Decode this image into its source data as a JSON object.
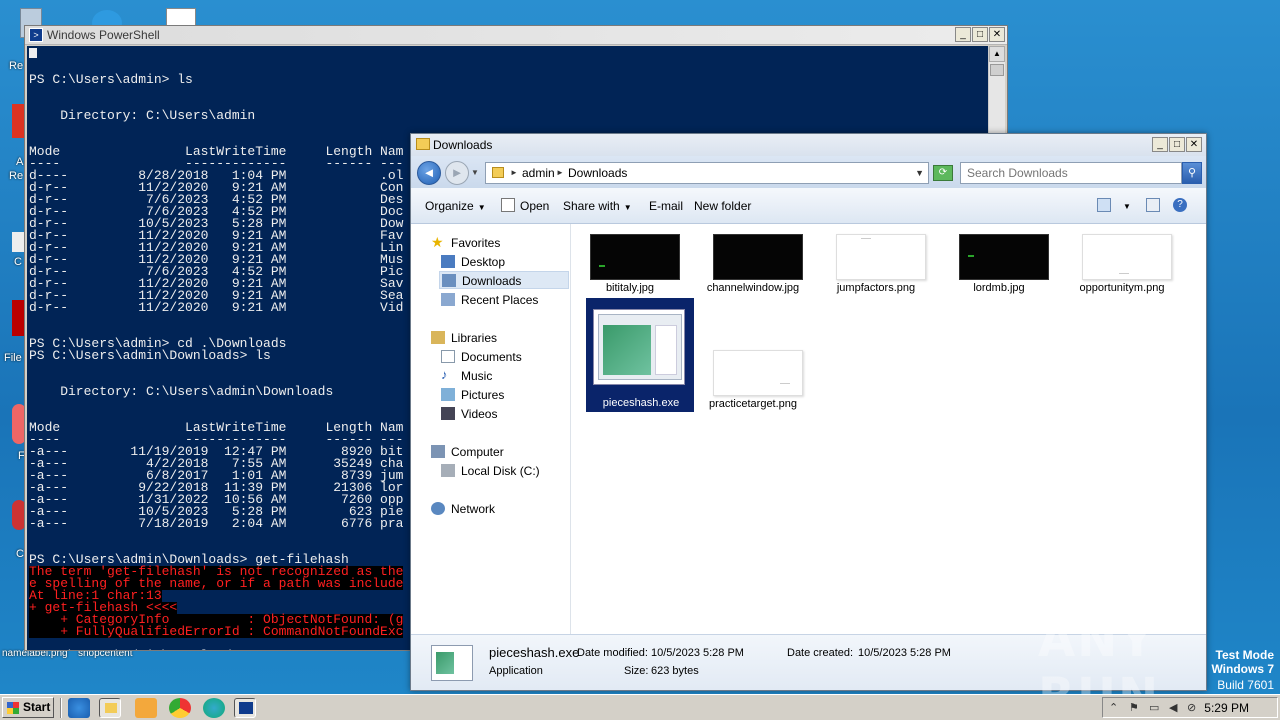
{
  "desktop": {
    "icon_labels": [
      "Re",
      "A",
      "Re",
      "C",
      "File",
      "F",
      "C",
      "namelabel.png",
      "snopcentent"
    ]
  },
  "powershell": {
    "title": "Windows PowerShell",
    "lines": [
      {
        "text": "PS C:\\Users\\admin> ls",
        "type": "normal"
      },
      {
        "text": "",
        "type": "normal"
      },
      {
        "text": "",
        "type": "normal"
      },
      {
        "text": "    Directory: C:\\Users\\admin",
        "type": "normal"
      },
      {
        "text": "",
        "type": "normal"
      },
      {
        "text": "",
        "type": "normal"
      },
      {
        "text": "Mode                LastWriteTime     Length Nam",
        "type": "normal"
      },
      {
        "text": "----                -------------     ------ ---",
        "type": "normal"
      },
      {
        "text": "d----         8/28/2018   1:04 PM            .ol",
        "type": "normal"
      },
      {
        "text": "d-r--         11/2/2020   9:21 AM            Con",
        "type": "normal"
      },
      {
        "text": "d-r--          7/6/2023   4:52 PM            Des",
        "type": "normal"
      },
      {
        "text": "d-r--          7/6/2023   4:52 PM            Doc",
        "type": "normal"
      },
      {
        "text": "d-r--         10/5/2023   5:28 PM            Dow",
        "type": "normal"
      },
      {
        "text": "d-r--         11/2/2020   9:21 AM            Fav",
        "type": "normal"
      },
      {
        "text": "d-r--         11/2/2020   9:21 AM            Lin",
        "type": "normal"
      },
      {
        "text": "d-r--         11/2/2020   9:21 AM            Mus",
        "type": "normal"
      },
      {
        "text": "d-r--          7/6/2023   4:52 PM            Pic",
        "type": "normal"
      },
      {
        "text": "d-r--         11/2/2020   9:21 AM            Sav",
        "type": "normal"
      },
      {
        "text": "d-r--         11/2/2020   9:21 AM            Sea",
        "type": "normal"
      },
      {
        "text": "d-r--         11/2/2020   9:21 AM            Vid",
        "type": "normal"
      },
      {
        "text": "",
        "type": "normal"
      },
      {
        "text": "",
        "type": "normal"
      },
      {
        "text": "PS C:\\Users\\admin> cd .\\Downloads",
        "type": "normal"
      },
      {
        "text": "PS C:\\Users\\admin\\Downloads> ls",
        "type": "normal"
      },
      {
        "text": "",
        "type": "normal"
      },
      {
        "text": "",
        "type": "normal"
      },
      {
        "text": "    Directory: C:\\Users\\admin\\Downloads",
        "type": "normal"
      },
      {
        "text": "",
        "type": "normal"
      },
      {
        "text": "",
        "type": "normal"
      },
      {
        "text": "Mode                LastWriteTime     Length Nam",
        "type": "normal"
      },
      {
        "text": "----                -------------     ------ ---",
        "type": "normal"
      },
      {
        "text": "-a---        11/19/2019  12:47 PM       8920 bit",
        "type": "normal"
      },
      {
        "text": "-a---          4/2/2018   7:55 AM      35249 cha",
        "type": "normal"
      },
      {
        "text": "-a---          6/8/2017   1:01 AM       8739 jum",
        "type": "normal"
      },
      {
        "text": "-a---         9/22/2018  11:39 PM      21306 lor",
        "type": "normal"
      },
      {
        "text": "-a---         1/31/2022  10:56 AM       7260 opp",
        "type": "normal"
      },
      {
        "text": "-a---         10/5/2023   5:28 PM        623 pie",
        "type": "normal"
      },
      {
        "text": "-a---         7/18/2019   2:04 AM       6776 pra",
        "type": "normal"
      },
      {
        "text": "",
        "type": "normal"
      },
      {
        "text": "",
        "type": "normal"
      },
      {
        "text": "PS C:\\Users\\admin\\Downloads> get-filehash",
        "type": "normal"
      },
      {
        "text": "The term 'get-filehash' is not recognized as the",
        "type": "error"
      },
      {
        "text": "e spelling of the name, or if a path was include",
        "type": "error"
      },
      {
        "text": "At line:1 char:13",
        "type": "error"
      },
      {
        "text": "+ get-filehash <<<<",
        "type": "error"
      },
      {
        "text": "    + CategoryInfo          : ObjectNotFound: (g",
        "type": "error"
      },
      {
        "text": "    + FullyQualifiedErrorId : CommandNotFoundExc",
        "type": "error"
      },
      {
        "text": "",
        "type": "normal"
      },
      {
        "text": "PS C:\\Users\\admin\\Downloads>",
        "type": "normal"
      }
    ]
  },
  "explorer": {
    "title": "Downloads",
    "breadcrumb": [
      "admin",
      "Downloads"
    ],
    "search_placeholder": "Search Downloads",
    "toolbar": {
      "organize": "Organize",
      "open": "Open",
      "share_with": "Share with",
      "email": "E-mail",
      "new_folder": "New folder"
    },
    "nav": {
      "favorites": "Favorites",
      "desktop": "Desktop",
      "downloads": "Downloads",
      "recent_places": "Recent Places",
      "libraries": "Libraries",
      "documents": "Documents",
      "music": "Music",
      "pictures": "Pictures",
      "videos": "Videos",
      "computer": "Computer",
      "local_disk": "Local Disk (C:)",
      "network": "Network"
    },
    "files": [
      {
        "name": "bititaly.jpg",
        "thumb": "black"
      },
      {
        "name": "channelwindow.jpg",
        "thumb": "black"
      },
      {
        "name": "jumpfactors.png",
        "thumb": "white"
      },
      {
        "name": "lordmb.jpg",
        "thumb": "black"
      },
      {
        "name": "opportunitym.png",
        "thumb": "white"
      },
      {
        "name": "pieceshash.exe",
        "thumb": "exe",
        "selected": true
      },
      {
        "name": "practicetarget.png",
        "thumb": "white"
      }
    ],
    "details": {
      "name": "pieceshash.exe",
      "type": "Application",
      "modified_label": "Date modified:",
      "modified_value": "10/5/2023 5:28 PM",
      "created_label": "Date created:",
      "created_value": "10/5/2023 5:28 PM",
      "size_label": "Size:",
      "size_value": "623 bytes"
    }
  },
  "watermark": {
    "logo_text": "ANY RUN",
    "mode": "Test Mode",
    "os": "Windows 7",
    "build": "Build 7601"
  },
  "taskbar": {
    "start_label": "Start",
    "clock": "5:29 PM"
  }
}
